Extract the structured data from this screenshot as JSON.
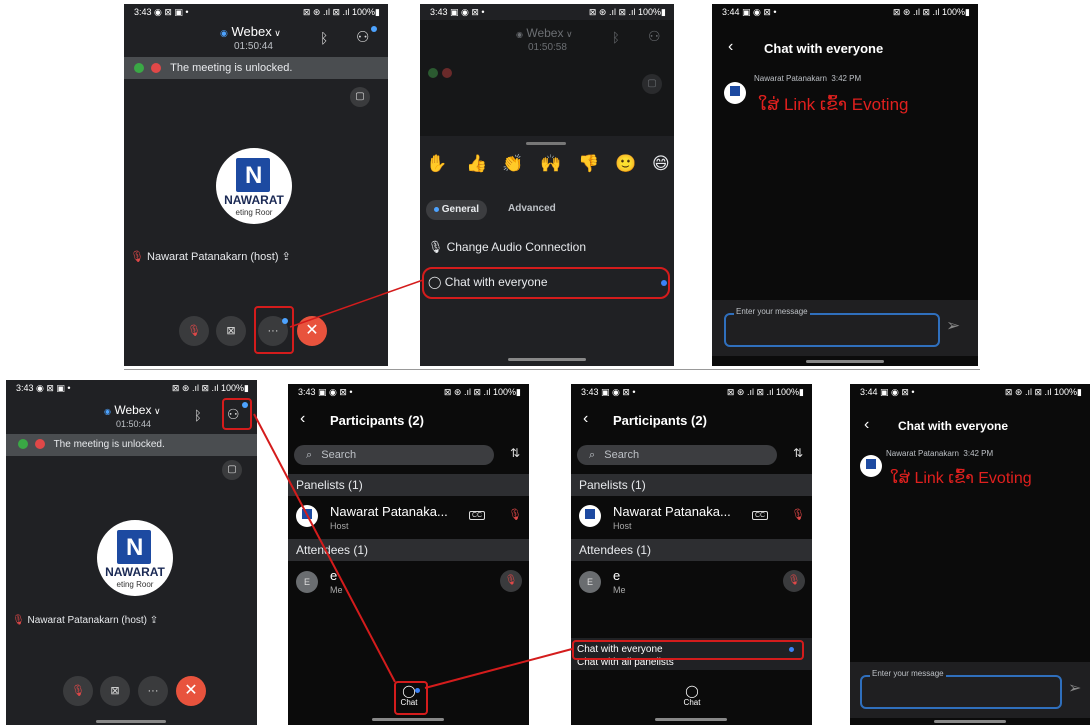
{
  "status": {
    "p1": {
      "time": "3:43 ◉ ⊠ ▣  •",
      "right": "⊠ ⊛ .ıl ⊠ .ıl 100%▮"
    },
    "p2": {
      "time": "3:43 ▣ ◉ ⊠  •",
      "right": "⊠ ⊛ .ıl ⊠ .ıl 100%▮"
    },
    "p3": {
      "time": "3:44 ▣ ◉ ⊠  •",
      "right": "⊠ ⊛ .ıl ⊠ .ıl 100%▮"
    },
    "p4": {
      "time": "3:43 ◉ ⊠ ▣  •",
      "right": "⊠ ⊛ .ıl ⊠ .ıl 100%▮"
    },
    "p5": {
      "time": "3:43 ▣ ◉ ⊠  •",
      "right": "⊠ ⊛ .ıl ⊠ .ıl 100%▮"
    },
    "p6": {
      "time": "3:43 ▣ ◉ ⊠  •",
      "right": "⊠ ⊛ .ıl ⊠ .ıl 100%▮"
    },
    "p7": {
      "time": "3:44 ▣ ◉ ⊠  •",
      "right": "⊠ ⊛ .ıl ⊠ .ıl 100%▮"
    }
  },
  "meeting": {
    "app": "Webex",
    "timer1": "01:50:44",
    "timer2": "01:50:58",
    "banner": "The meeting is unlocked.",
    "host_label": "Nawarat Patanakarn (host)",
    "logo_text": "NAWARAT",
    "logo_sub": "eting Roor",
    "more": "···",
    "close": "✕"
  },
  "menu": {
    "emojis": [
      "✋",
      "👍",
      "👏",
      "🙌",
      "👎",
      "🙂",
      "😄"
    ],
    "tab_general": "General",
    "tab_advanced": "Advanced",
    "audio": "Change Audio Connection",
    "chat": "Chat with everyone"
  },
  "chat": {
    "title": "Chat with everyone",
    "sender": "Nawarat Patanakarn",
    "time": "3:42 PM",
    "message": "ໃສ່ Link ເຂົ້າ Evoting",
    "placeholder": "Enter your message"
  },
  "participants": {
    "title": "Participants (2)",
    "search": "Search",
    "panelists": "Panelists (1)",
    "attendees": "Attendees (1)",
    "host_name": "Nawarat Patanaka...",
    "host_role": "Host",
    "attendee_name": "e",
    "attendee_role": "Me",
    "attendee_initial": "E",
    "cc": "CC",
    "chat_tab": "Chat",
    "chat_all": "Chat with everyone",
    "chat_panelists": "Chat with all panelists"
  },
  "colors": {
    "accent": "#3b82f6",
    "annotation": "#d41c1c",
    "message": "#e0201e"
  }
}
